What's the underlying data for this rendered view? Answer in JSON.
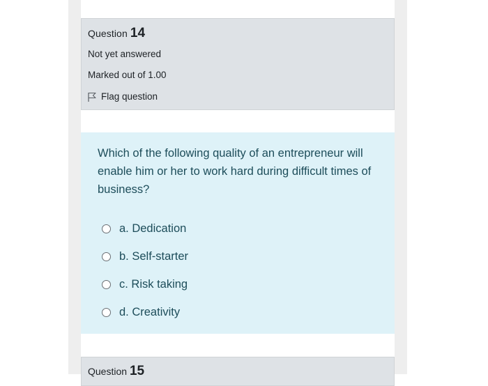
{
  "question": {
    "label": "Question",
    "number": "14",
    "state": "Not yet answered",
    "grade": "Marked out of 1.00",
    "flag_label": "Flag question",
    "text": "Which of the following quality of an entrepreneur will enable him or her to work hard during difficult times of business?",
    "options": [
      {
        "label": "a. Dedication"
      },
      {
        "label": "b. Self-starter"
      },
      {
        "label": "c. Risk taking"
      },
      {
        "label": "d. Creativity"
      }
    ]
  },
  "next_question": {
    "label": "Question",
    "number": "15"
  },
  "colors": {
    "info_bg": "#dee2e6",
    "formulation_bg": "#def2f8",
    "question_text": "#1d4d5a",
    "page_side": "#eeeeee"
  },
  "icons": {
    "flag": "flag-icon",
    "radio": "radio-button-icon"
  }
}
